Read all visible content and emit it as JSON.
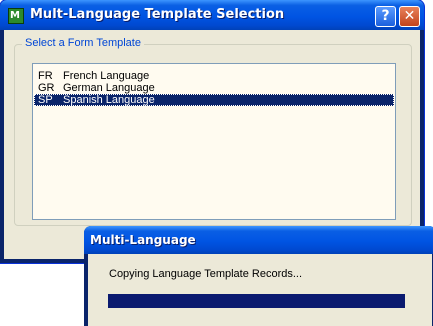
{
  "main_window": {
    "title": "Mult-Language Template Selection",
    "icon": "app-icon",
    "icon_text": "M",
    "help_label": "?",
    "close_label": "✕",
    "group_label": "Select a Form Template",
    "templates": [
      {
        "code": "FR",
        "name": "French Language"
      },
      {
        "code": "GR",
        "name": "German Language"
      },
      {
        "code": "SP",
        "name": "Spanish Language"
      }
    ],
    "selected_index": 2
  },
  "progress_dialog": {
    "title": "Multi-Language",
    "message": "Copying Language Template Records...",
    "progress": 1.0
  },
  "colors": {
    "titlebar": "#0054e3",
    "selection": "#0a246a",
    "progress_fill": "#0a1a6f",
    "group_label": "#0046d5"
  }
}
